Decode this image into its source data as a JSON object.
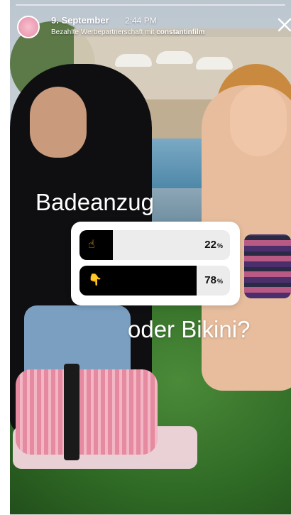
{
  "header": {
    "date": "9. September",
    "time": "2:44 PM",
    "sponsor_text": "Bezahlte Werbepartnerschaft mit",
    "sponsor_name": "constantinfilm",
    "avatar_icon": "profile-avatar-icon",
    "close_icon": "close-icon"
  },
  "poll": {
    "question_line1": "Badeanzug",
    "question_line2": "oder Bikini?",
    "options": [
      {
        "emoji_icon": "hand-pointing-up-icon",
        "emoji": "☝",
        "percent": "22",
        "percent_value": 22,
        "unit": "%"
      },
      {
        "emoji_icon": "hand-pointing-down-icon",
        "emoji": "👇",
        "percent": "78",
        "percent_value": 78,
        "unit": "%"
      }
    ],
    "colors": {
      "fill": "#000000",
      "track": "#ececec",
      "emoji": "#f2b233"
    }
  }
}
